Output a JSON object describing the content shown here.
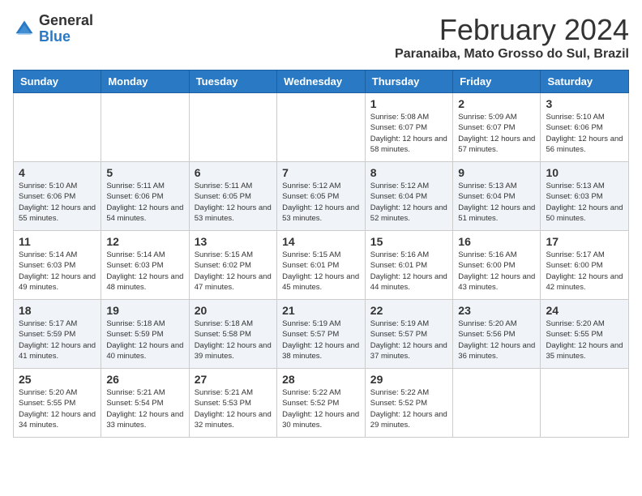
{
  "logo": {
    "general": "General",
    "blue": "Blue"
  },
  "header": {
    "month": "February 2024",
    "location": "Paranaiba, Mato Grosso do Sul, Brazil"
  },
  "days_of_week": [
    "Sunday",
    "Monday",
    "Tuesday",
    "Wednesday",
    "Thursday",
    "Friday",
    "Saturday"
  ],
  "weeks": [
    [
      {
        "day": "",
        "info": ""
      },
      {
        "day": "",
        "info": ""
      },
      {
        "day": "",
        "info": ""
      },
      {
        "day": "",
        "info": ""
      },
      {
        "day": "1",
        "info": "Sunrise: 5:08 AM\nSunset: 6:07 PM\nDaylight: 12 hours and 58 minutes."
      },
      {
        "day": "2",
        "info": "Sunrise: 5:09 AM\nSunset: 6:07 PM\nDaylight: 12 hours and 57 minutes."
      },
      {
        "day": "3",
        "info": "Sunrise: 5:10 AM\nSunset: 6:06 PM\nDaylight: 12 hours and 56 minutes."
      }
    ],
    [
      {
        "day": "4",
        "info": "Sunrise: 5:10 AM\nSunset: 6:06 PM\nDaylight: 12 hours and 55 minutes."
      },
      {
        "day": "5",
        "info": "Sunrise: 5:11 AM\nSunset: 6:06 PM\nDaylight: 12 hours and 54 minutes."
      },
      {
        "day": "6",
        "info": "Sunrise: 5:11 AM\nSunset: 6:05 PM\nDaylight: 12 hours and 53 minutes."
      },
      {
        "day": "7",
        "info": "Sunrise: 5:12 AM\nSunset: 6:05 PM\nDaylight: 12 hours and 53 minutes."
      },
      {
        "day": "8",
        "info": "Sunrise: 5:12 AM\nSunset: 6:04 PM\nDaylight: 12 hours and 52 minutes."
      },
      {
        "day": "9",
        "info": "Sunrise: 5:13 AM\nSunset: 6:04 PM\nDaylight: 12 hours and 51 minutes."
      },
      {
        "day": "10",
        "info": "Sunrise: 5:13 AM\nSunset: 6:03 PM\nDaylight: 12 hours and 50 minutes."
      }
    ],
    [
      {
        "day": "11",
        "info": "Sunrise: 5:14 AM\nSunset: 6:03 PM\nDaylight: 12 hours and 49 minutes."
      },
      {
        "day": "12",
        "info": "Sunrise: 5:14 AM\nSunset: 6:03 PM\nDaylight: 12 hours and 48 minutes."
      },
      {
        "day": "13",
        "info": "Sunrise: 5:15 AM\nSunset: 6:02 PM\nDaylight: 12 hours and 47 minutes."
      },
      {
        "day": "14",
        "info": "Sunrise: 5:15 AM\nSunset: 6:01 PM\nDaylight: 12 hours and 45 minutes."
      },
      {
        "day": "15",
        "info": "Sunrise: 5:16 AM\nSunset: 6:01 PM\nDaylight: 12 hours and 44 minutes."
      },
      {
        "day": "16",
        "info": "Sunrise: 5:16 AM\nSunset: 6:00 PM\nDaylight: 12 hours and 43 minutes."
      },
      {
        "day": "17",
        "info": "Sunrise: 5:17 AM\nSunset: 6:00 PM\nDaylight: 12 hours and 42 minutes."
      }
    ],
    [
      {
        "day": "18",
        "info": "Sunrise: 5:17 AM\nSunset: 5:59 PM\nDaylight: 12 hours and 41 minutes."
      },
      {
        "day": "19",
        "info": "Sunrise: 5:18 AM\nSunset: 5:59 PM\nDaylight: 12 hours and 40 minutes."
      },
      {
        "day": "20",
        "info": "Sunrise: 5:18 AM\nSunset: 5:58 PM\nDaylight: 12 hours and 39 minutes."
      },
      {
        "day": "21",
        "info": "Sunrise: 5:19 AM\nSunset: 5:57 PM\nDaylight: 12 hours and 38 minutes."
      },
      {
        "day": "22",
        "info": "Sunrise: 5:19 AM\nSunset: 5:57 PM\nDaylight: 12 hours and 37 minutes."
      },
      {
        "day": "23",
        "info": "Sunrise: 5:20 AM\nSunset: 5:56 PM\nDaylight: 12 hours and 36 minutes."
      },
      {
        "day": "24",
        "info": "Sunrise: 5:20 AM\nSunset: 5:55 PM\nDaylight: 12 hours and 35 minutes."
      }
    ],
    [
      {
        "day": "25",
        "info": "Sunrise: 5:20 AM\nSunset: 5:55 PM\nDaylight: 12 hours and 34 minutes."
      },
      {
        "day": "26",
        "info": "Sunrise: 5:21 AM\nSunset: 5:54 PM\nDaylight: 12 hours and 33 minutes."
      },
      {
        "day": "27",
        "info": "Sunrise: 5:21 AM\nSunset: 5:53 PM\nDaylight: 12 hours and 32 minutes."
      },
      {
        "day": "28",
        "info": "Sunrise: 5:22 AM\nSunset: 5:52 PM\nDaylight: 12 hours and 30 minutes."
      },
      {
        "day": "29",
        "info": "Sunrise: 5:22 AM\nSunset: 5:52 PM\nDaylight: 12 hours and 29 minutes."
      },
      {
        "day": "",
        "info": ""
      },
      {
        "day": "",
        "info": ""
      }
    ]
  ]
}
